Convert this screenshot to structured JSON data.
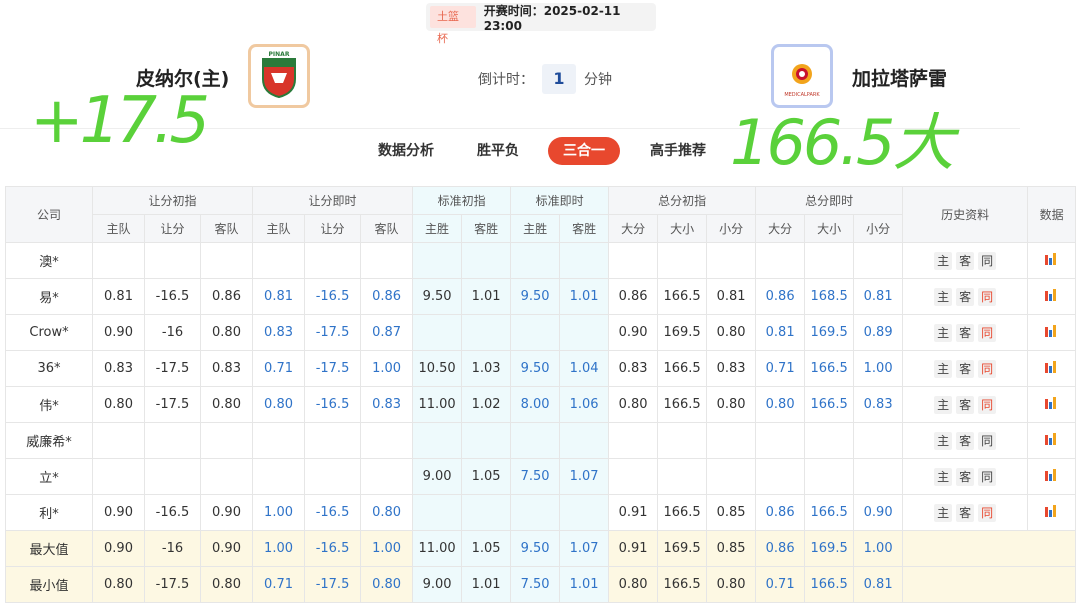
{
  "header": {
    "league": "土篮杯",
    "kickoff": "开赛时间：2025-02-11 23:00",
    "home_team": "皮纳尔(主)",
    "away_team": "加拉塔萨雷",
    "home_logo_text": "PINAR",
    "away_logo_text": "MEDICALPARK",
    "countdown_label": "倒计时：",
    "countdown_value": "1",
    "countdown_unit": "分钟"
  },
  "tabs": [
    "数据分析",
    "胜平负",
    "三合一",
    "高手推荐"
  ],
  "active_tab": 2,
  "handwriting": {
    "left": "+17.5",
    "right": "166.5大"
  },
  "table": {
    "group_headers": [
      "公司",
      "让分初指",
      "让分即时",
      "标准初指",
      "标准即时",
      "总分初指",
      "总分即时",
      "历史资料",
      "数据"
    ],
    "sub_headers": [
      "主队",
      "让分",
      "客队",
      "主队",
      "让分",
      "客队",
      "主胜",
      "客胜",
      "主胜",
      "客胜",
      "大分",
      "大小",
      "小分",
      "大分",
      "大小",
      "小分"
    ],
    "hist_buttons": [
      "主",
      "客",
      "同"
    ],
    "rows": [
      {
        "company": "澳*",
        "c": [
          "",
          "",
          "",
          "",
          "",
          "",
          "",
          "",
          "",
          "",
          "",
          "",
          "",
          "",
          "",
          ""
        ],
        "red": false
      },
      {
        "company": "易*",
        "c": [
          "0.81",
          "-16.5",
          "0.86",
          "0.81",
          "-16.5",
          "0.86",
          "9.50",
          "1.01",
          "9.50",
          "1.01",
          "0.86",
          "166.5",
          "0.81",
          "0.86",
          "168.5",
          "0.81"
        ],
        "red": true
      },
      {
        "company": "Crow*",
        "c": [
          "0.90",
          "-16",
          "0.80",
          "0.83",
          "-17.5",
          "0.87",
          "",
          "",
          "",
          "",
          "0.90",
          "169.5",
          "0.80",
          "0.81",
          "169.5",
          "0.89"
        ],
        "red": true
      },
      {
        "company": "36*",
        "c": [
          "0.83",
          "-17.5",
          "0.83",
          "0.71",
          "-17.5",
          "1.00",
          "10.50",
          "1.03",
          "9.50",
          "1.04",
          "0.83",
          "166.5",
          "0.83",
          "0.71",
          "166.5",
          "1.00"
        ],
        "red": true
      },
      {
        "company": "伟*",
        "c": [
          "0.80",
          "-17.5",
          "0.80",
          "0.80",
          "-16.5",
          "0.83",
          "11.00",
          "1.02",
          "8.00",
          "1.06",
          "0.80",
          "166.5",
          "0.80",
          "0.80",
          "166.5",
          "0.83"
        ],
        "red": true
      },
      {
        "company": "威廉希*",
        "c": [
          "",
          "",
          "",
          "",
          "",
          "",
          "",
          "",
          "",
          "",
          "",
          "",
          "",
          "",
          "",
          ""
        ],
        "red": false
      },
      {
        "company": "立*",
        "c": [
          "",
          "",
          "",
          "",
          "",
          "",
          "9.00",
          "1.05",
          "7.50",
          "1.07",
          "",
          "",
          "",
          "",
          "",
          ""
        ],
        "red": false
      },
      {
        "company": "利*",
        "c": [
          "0.90",
          "-16.5",
          "0.90",
          "1.00",
          "-16.5",
          "0.80",
          "",
          "",
          "",
          "",
          "0.91",
          "166.5",
          "0.85",
          "0.86",
          "166.5",
          "0.90"
        ],
        "red": true
      }
    ],
    "summary": [
      {
        "label": "最大值",
        "c": [
          "0.90",
          "-16",
          "0.90",
          "1.00",
          "-16.5",
          "1.00",
          "11.00",
          "1.05",
          "9.50",
          "1.07",
          "0.91",
          "169.5",
          "0.85",
          "0.86",
          "169.5",
          "1.00"
        ]
      },
      {
        "label": "最小值",
        "c": [
          "0.80",
          "-17.5",
          "0.80",
          "0.71",
          "-17.5",
          "0.80",
          "9.00",
          "1.01",
          "7.50",
          "1.01",
          "0.80",
          "166.5",
          "0.80",
          "0.71",
          "166.5",
          "0.81"
        ]
      }
    ]
  },
  "colors": {
    "accent": "#e8482e",
    "blue_value": "#2f73c8",
    "handwriting": "#5ad13a"
  }
}
